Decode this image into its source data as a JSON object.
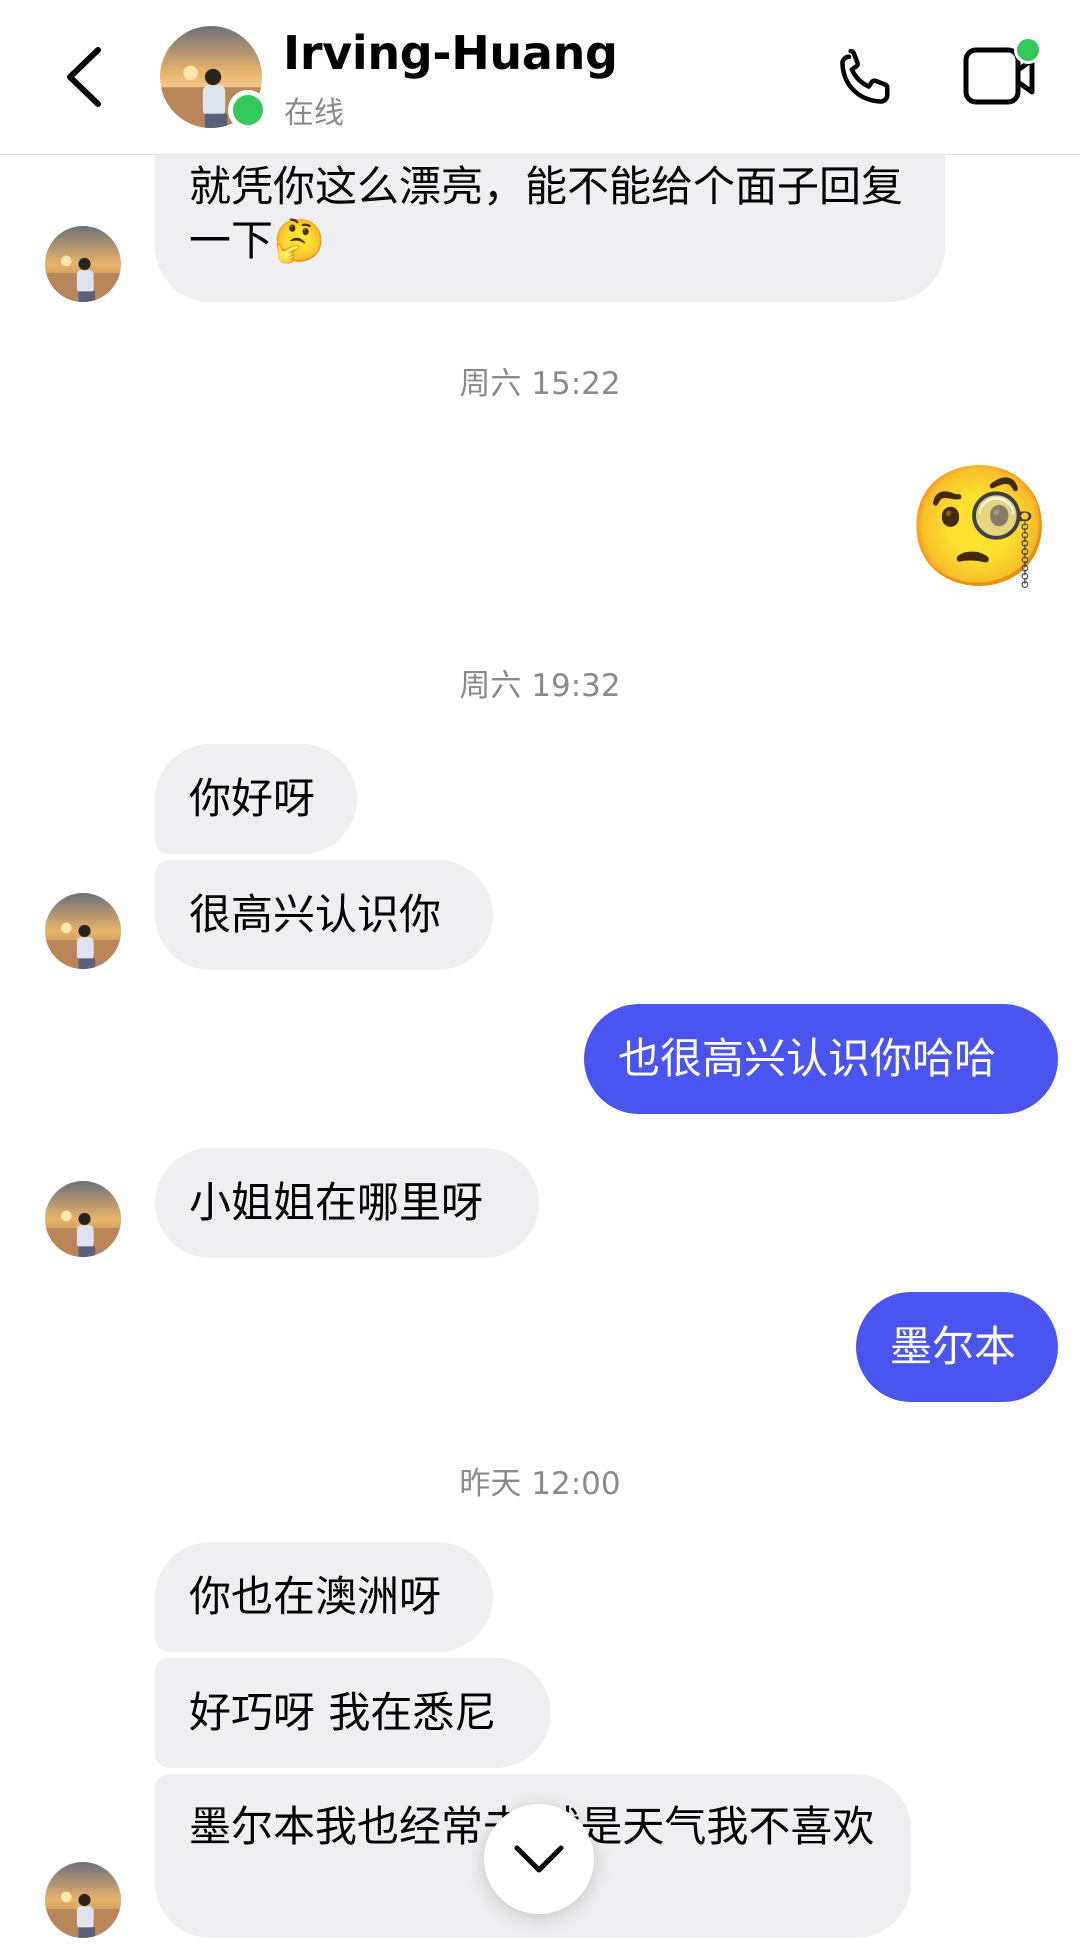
{
  "header": {
    "contact_name": "Irving-Huang",
    "status": "在线"
  },
  "messages": {
    "m1": "就凭你这么漂亮，能不能给个面子回复一下🤔",
    "ts1": "周六 15:22",
    "sticker": "🧐",
    "ts2": "周六 19:32",
    "m2": "你好呀",
    "m3": "很高兴认识你",
    "m4": "也很高兴认识你哈哈",
    "m5": "小姐姐在哪里呀",
    "m6": "墨尔本",
    "ts3": "昨天 12:00",
    "m7": "你也在澳洲呀",
    "m8": "好巧呀 我在悉尼",
    "m9": "墨尔本我也经常去 就是天气我不喜欢"
  },
  "colors": {
    "outgoing_bubble": "#4a54ee",
    "incoming_bubble": "#efeff1",
    "online_green": "#34c759"
  },
  "icons": [
    "back-chevron-icon",
    "phone-icon",
    "video-call-icon",
    "chevron-down-icon"
  ]
}
